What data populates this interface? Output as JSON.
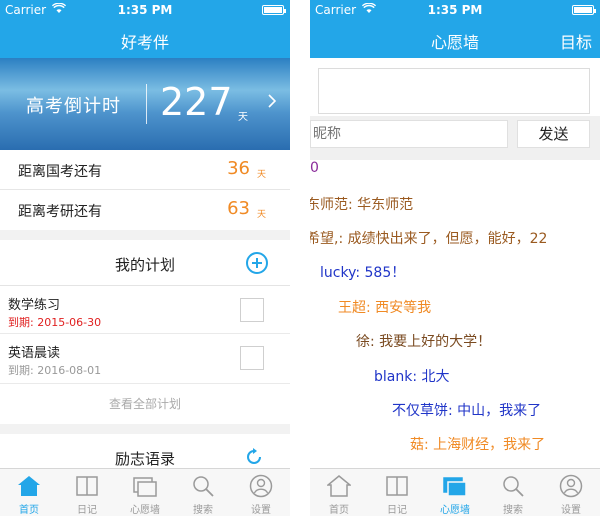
{
  "left": {
    "status": {
      "carrier": "Carrier",
      "time": "1:35 PM"
    },
    "nav_title": "好考伴",
    "countdown": {
      "label": "高考倒计时",
      "days": "227",
      "unit": "天"
    },
    "rows": [
      {
        "text": "距离国考还有",
        "value": "36",
        "unit": "天"
      },
      {
        "text": "距离考研还有",
        "value": "63",
        "unit": "天"
      }
    ],
    "plans_title": "我的计划",
    "plans": [
      {
        "name": "数学练习",
        "due_label": "到期:",
        "due": "2015-06-30",
        "color": "#e02020"
      },
      {
        "name": "英语晨读",
        "due_label": "到期:",
        "due": "2016-08-01",
        "color": "#999999"
      }
    ],
    "view_all": "查看全部计划",
    "quotes_title": "励志语录",
    "tabs": [
      {
        "label": "首页",
        "icon": "home-icon",
        "active": true
      },
      {
        "label": "日记",
        "icon": "book-icon",
        "active": false
      },
      {
        "label": "心愿墙",
        "icon": "wall-icon",
        "active": false
      },
      {
        "label": "搜索",
        "icon": "search-icon",
        "active": false
      },
      {
        "label": "设置",
        "icon": "user-icon",
        "active": false
      }
    ]
  },
  "right": {
    "status": {
      "carrier": "Carrier",
      "time": "1:35 PM"
    },
    "nav_title": "心愿墙",
    "nav_right": "目标",
    "nick_placeholder": "昵称",
    "send_label": "发送",
    "wishes": [
      {
        "text": "0",
        "color": "#8a2a9a"
      },
      {
        "text": "东师范: 华东师范",
        "color": "#9a5a20"
      },
      {
        "text": "希望,: 成绩快出来了，但愿，能好，22",
        "color": "#9a5a20"
      },
      {
        "text": "lucky: 585！",
        "color": "#2035c8"
      },
      {
        "text": "王超: 西安等我",
        "color": "#f08a24"
      },
      {
        "text": "徐: 我要上好的大学！",
        "color": "#7a4a20"
      },
      {
        "text": "blank: 北大",
        "color": "#2035c8"
      },
      {
        "text": "不仅草饼: 中山，我来了",
        "color": "#2035c8"
      },
      {
        "text": "菇: 上海财经，我来了",
        "color": "#f08a24"
      }
    ],
    "tabs": [
      {
        "label": "首页",
        "icon": "home-icon",
        "active": false
      },
      {
        "label": "日记",
        "icon": "book-icon",
        "active": false
      },
      {
        "label": "心愿墙",
        "icon": "wall-icon",
        "active": true
      },
      {
        "label": "搜索",
        "icon": "search-icon",
        "active": false
      },
      {
        "label": "设置",
        "icon": "user-icon",
        "active": false
      }
    ]
  },
  "colors": {
    "accent": "#23a6e8",
    "orange": "#f08a24",
    "tab_inactive": "#9a9a9a"
  }
}
